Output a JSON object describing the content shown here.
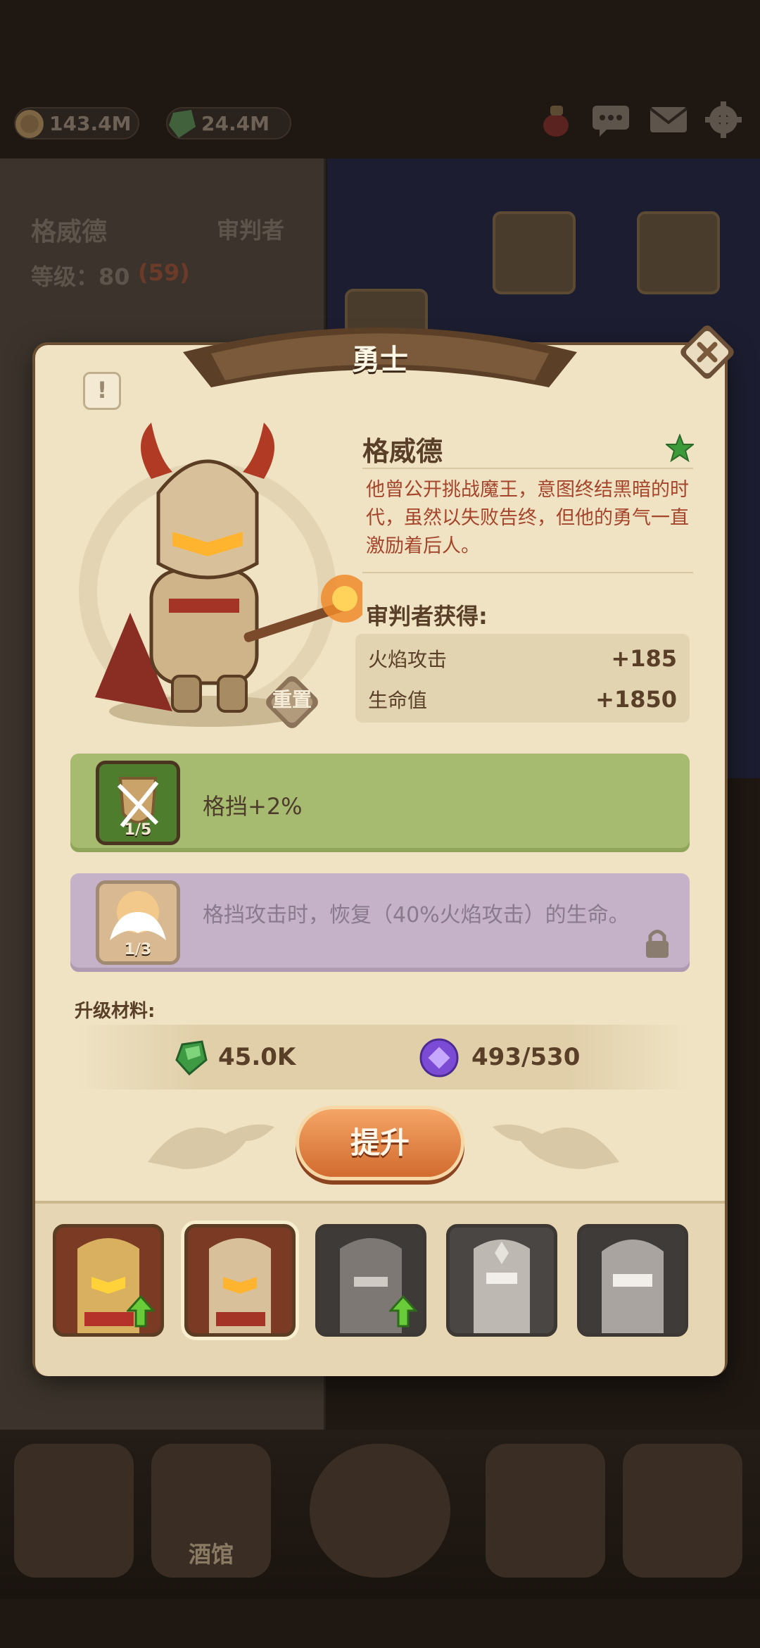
{
  "top_bar": {
    "gold": "143.4M",
    "gems": "24.4M"
  },
  "bg_panel": {
    "hero_name": "格威德",
    "hero_class": "审判者",
    "level_label": "等级：80",
    "level_bonus": "(59)"
  },
  "bottom_nav": {
    "tavern_label": "酒馆"
  },
  "modal": {
    "title": "勇士",
    "hero_name": "格威德",
    "description": "他曾公开挑战魔王，意图终结黑暗的时代，虽然以失败告终，但他的勇气一直激励着后人。",
    "gain_title": "审判者获得:",
    "stats": [
      {
        "name": "火焰攻击",
        "value": "+185"
      },
      {
        "name": "生命值",
        "value": "+1850"
      }
    ],
    "reset_label": "重置",
    "skills": [
      {
        "level": "1/5",
        "text": "格挡+2%",
        "locked": false
      },
      {
        "level": "1/3",
        "text": "格挡攻击时，恢复（40%火焰攻击）的生命。",
        "locked": true
      }
    ],
    "materials_label": "升级材料:",
    "materials": [
      {
        "icon": "green-gem-icon",
        "value": "45.0K"
      },
      {
        "icon": "purple-shard-icon",
        "value": "493/530"
      }
    ],
    "upgrade_label": "提升"
  },
  "colors": {
    "parchment": "#efe3c4",
    "skill_green": "#a6bb70",
    "skill_purple": "#c5b2c8",
    "upgrade_orange": "#d26b2f",
    "desc_red": "#a5452b"
  }
}
